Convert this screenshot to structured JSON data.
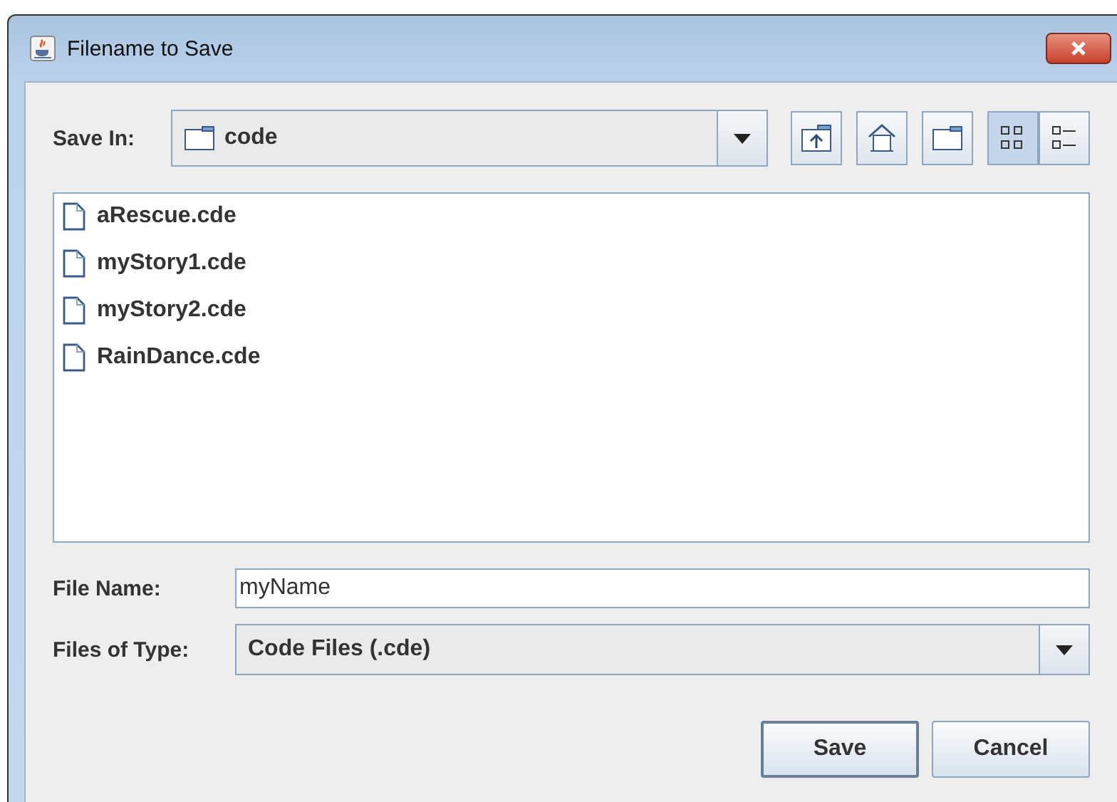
{
  "window": {
    "title": "Filename to Save"
  },
  "save_in": {
    "label": "Save In:",
    "value": "code"
  },
  "toolbar": [
    {
      "kind": "up",
      "selected": false
    },
    {
      "kind": "home",
      "selected": false
    },
    {
      "kind": "new-folder",
      "selected": false
    },
    {
      "kind": "list",
      "selected": true
    },
    {
      "kind": "details",
      "selected": false
    }
  ],
  "files": [
    {
      "name": "aRescue.cde"
    },
    {
      "name": "myStory1.cde"
    },
    {
      "name": "myStory2.cde"
    },
    {
      "name": "RainDance.cde"
    }
  ],
  "file_name": {
    "label": "File Name:",
    "value": "myName"
  },
  "file_type": {
    "label": "Files of Type:",
    "value": "Code Files (.cde)"
  },
  "buttons": [
    "Save",
    "Cancel"
  ]
}
